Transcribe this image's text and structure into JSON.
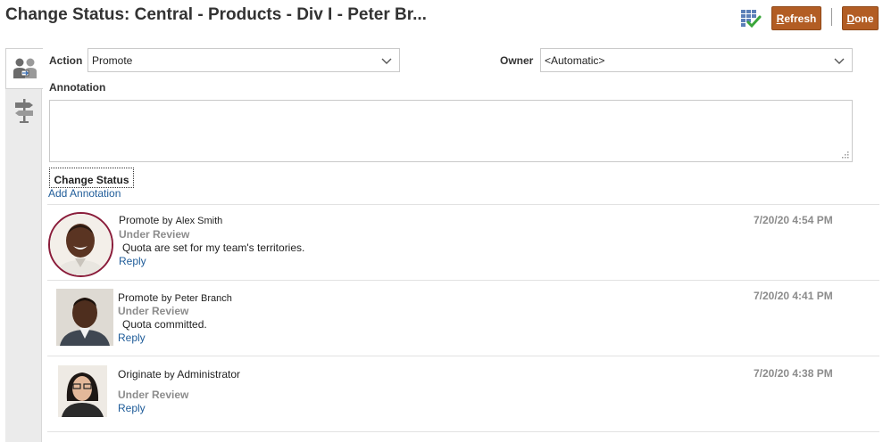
{
  "header": {
    "title": "Change Status: Central - Products - Div I - Peter Br...",
    "refresh_first": "R",
    "refresh_rest": "efresh",
    "done_first": "D",
    "done_rest": "one"
  },
  "sidebar": {
    "tabs": [
      {
        "icon": "users-approval-icon",
        "active": true
      },
      {
        "icon": "signpost-icon",
        "active": false
      }
    ]
  },
  "form": {
    "action_label": "Action",
    "action_value": "Promote",
    "owner_label": "Owner",
    "owner_value": "<Automatic>",
    "annotation_label": "Annotation",
    "change_status_label": "Change Status",
    "add_annotation_label": "Add Annotation"
  },
  "entries": [
    {
      "action": "Promote",
      "by": "by",
      "user": "Alex Smith",
      "status": "Under Review",
      "text": "Quota are set for my team's territories.",
      "reply": "Reply",
      "time": "7/20/20 4:54 PM"
    },
    {
      "action": "Promote",
      "by": "by",
      "user": "Peter Branch",
      "status": "Under Review",
      "text": "Quota committed.",
      "reply": "Reply",
      "time": "7/20/20 4:41 PM"
    },
    {
      "action": "Originate",
      "by": "by",
      "user": "Administrator",
      "status": "Under Review",
      "text": "",
      "reply": "Reply",
      "time": "7/20/20 4:38 PM"
    }
  ],
  "colors": {
    "button_bg": "#b25d24",
    "link": "#1f5c99",
    "muted": "#8c8c8c"
  }
}
